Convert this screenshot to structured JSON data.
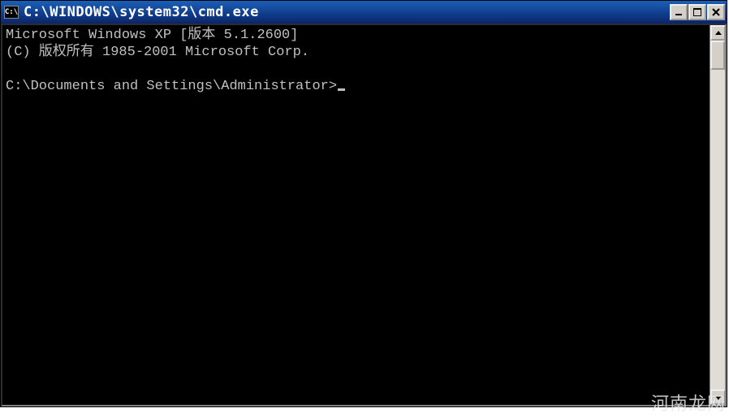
{
  "titlebar": {
    "icon_label": "C:\\",
    "title": "C:\\WINDOWS\\system32\\cmd.exe"
  },
  "console": {
    "line1": "Microsoft Windows XP [版本 5.1.2600]",
    "line2": "(C) 版权所有 1985-2001 Microsoft Corp.",
    "blank": "",
    "prompt": "C:\\Documents and Settings\\Administrator>"
  },
  "watermark": "河南龙网"
}
